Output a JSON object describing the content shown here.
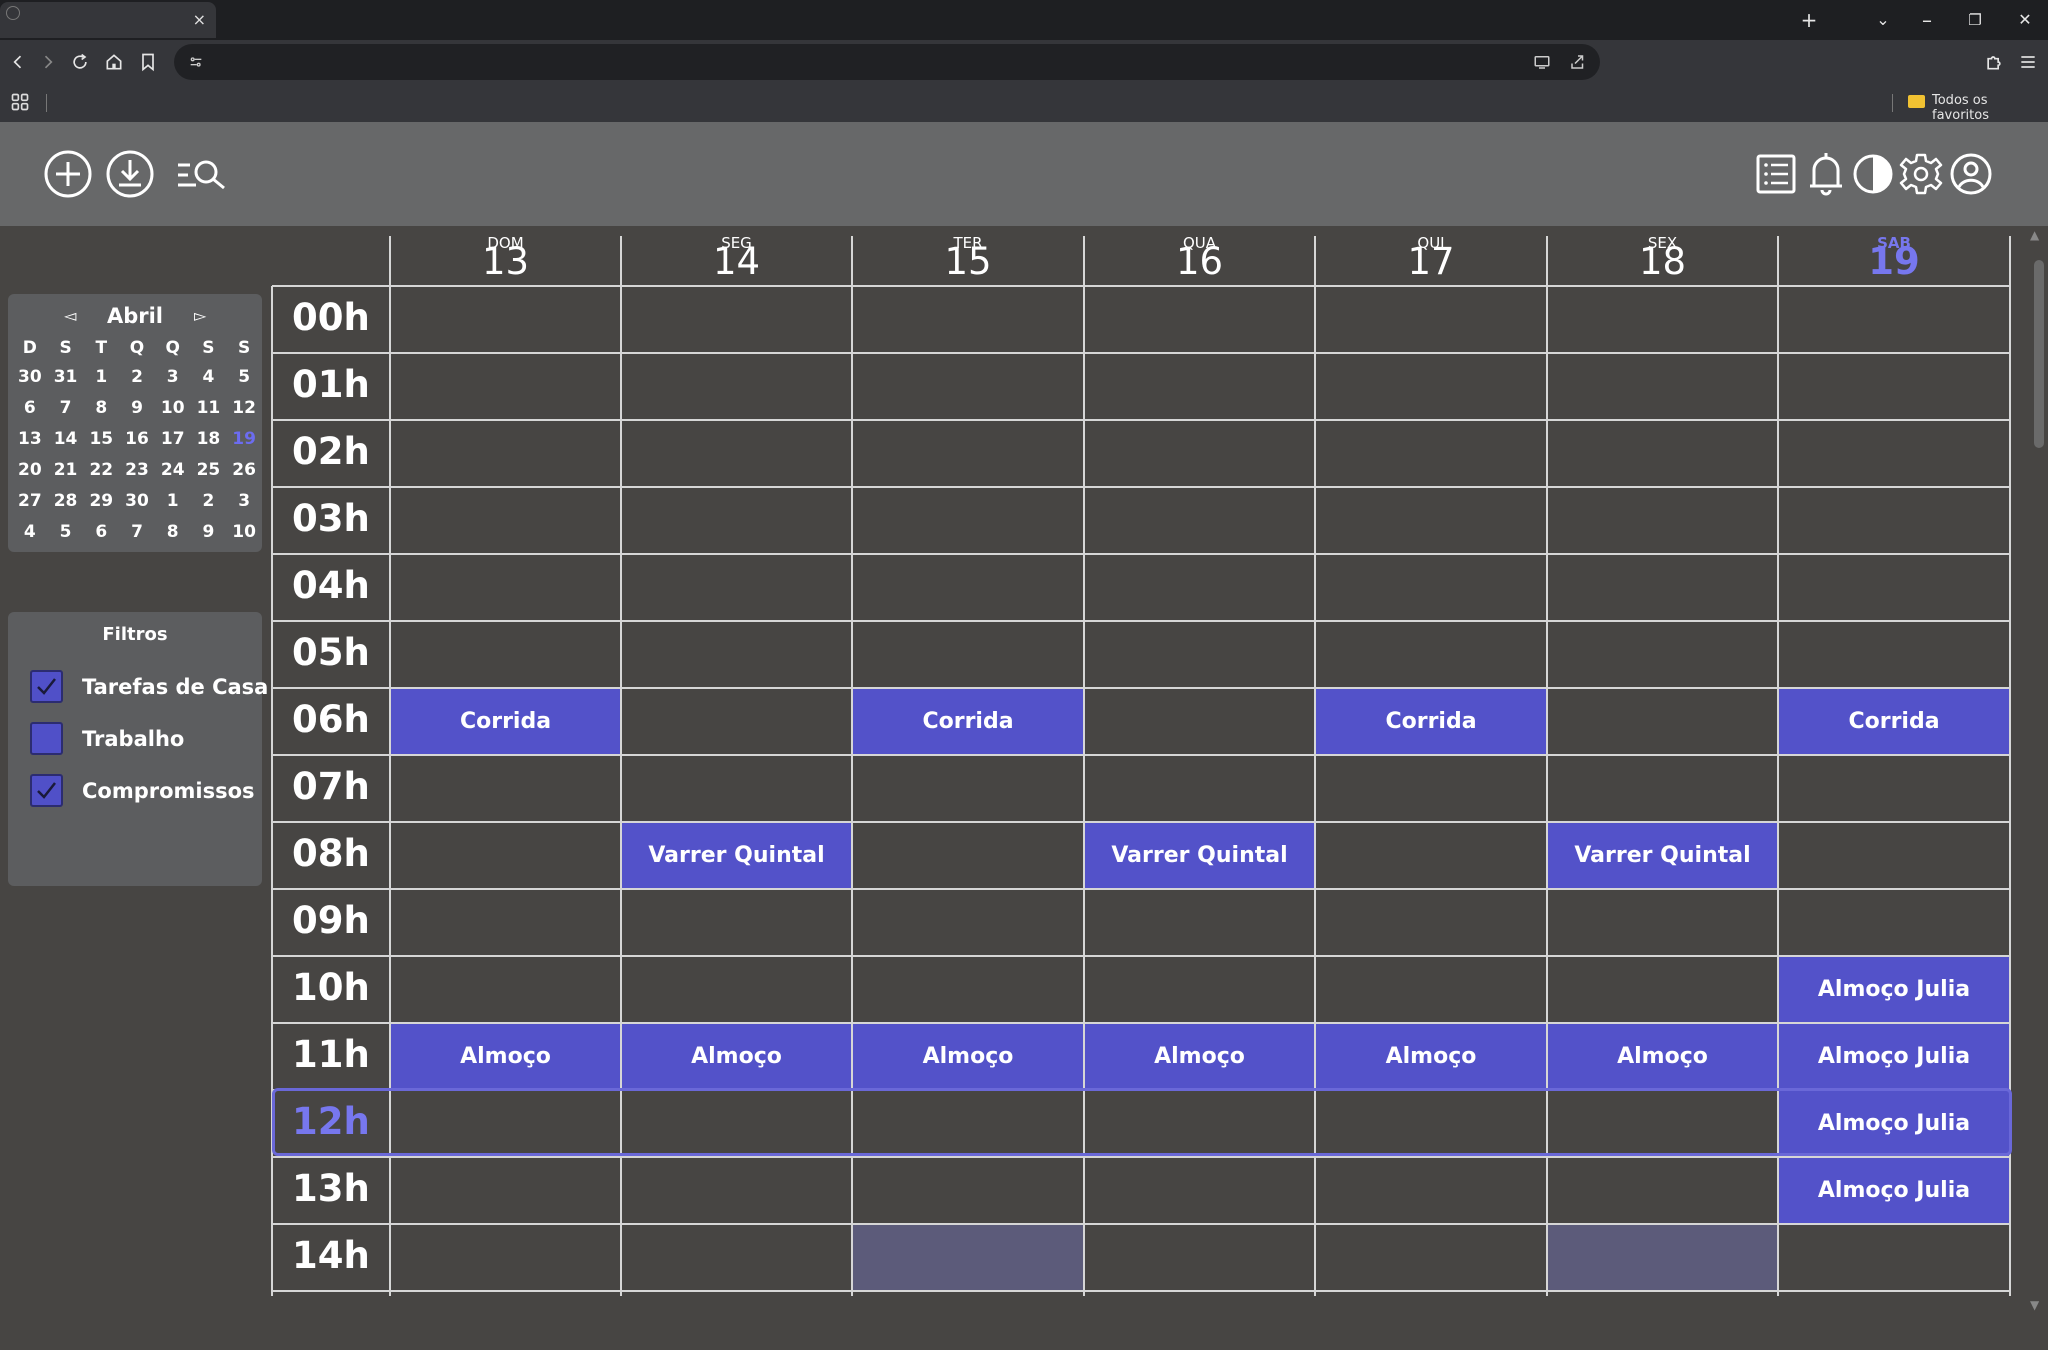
{
  "browser": {
    "tab_close": "×",
    "new_tab": "+",
    "tab_search": "⌄",
    "minimize": "–",
    "restore": "❐",
    "close": "✕",
    "bookmark_folder": "Todos os favoritos"
  },
  "calendar": {
    "month": "Abril",
    "prev": "◅",
    "next": "▻",
    "weekday_initials": [
      "D",
      "S",
      "T",
      "Q",
      "Q",
      "S",
      "S"
    ],
    "weeks": [
      [
        "30",
        "31",
        "1",
        "2",
        "3",
        "4",
        "5"
      ],
      [
        "6",
        "7",
        "8",
        "9",
        "10",
        "11",
        "12"
      ],
      [
        "13",
        "14",
        "15",
        "16",
        "17",
        "18",
        "19"
      ],
      [
        "20",
        "21",
        "22",
        "23",
        "24",
        "25",
        "26"
      ],
      [
        "27",
        "28",
        "29",
        "30",
        "1",
        "2",
        "3"
      ],
      [
        "4",
        "5",
        "6",
        "7",
        "8",
        "9",
        "10"
      ]
    ],
    "today": "19"
  },
  "filters": {
    "title": "Filtros",
    "items": [
      {
        "label": "Tarefas de Casa",
        "checked": true
      },
      {
        "label": "Trabalho",
        "checked": false
      },
      {
        "label": "Compromissos",
        "checked": true
      }
    ]
  },
  "week": {
    "days": [
      {
        "dow": "DOM",
        "num": "13"
      },
      {
        "dow": "SEG",
        "num": "14"
      },
      {
        "dow": "TER",
        "num": "15"
      },
      {
        "dow": "QUA",
        "num": "16"
      },
      {
        "dow": "QUI",
        "num": "17"
      },
      {
        "dow": "SEX",
        "num": "18"
      },
      {
        "dow": "SAB",
        "num": "19",
        "today": true
      }
    ],
    "hours": [
      "00h",
      "01h",
      "02h",
      "03h",
      "04h",
      "05h",
      "06h",
      "07h",
      "08h",
      "09h",
      "10h",
      "11h",
      "12h",
      "13h",
      "14h"
    ],
    "current_hour": "12h",
    "events": [
      {
        "title": "Corrida",
        "day": 0,
        "hour": 6
      },
      {
        "title": "Corrida",
        "day": 2,
        "hour": 6
      },
      {
        "title": "Corrida",
        "day": 4,
        "hour": 6
      },
      {
        "title": "Corrida",
        "day": 6,
        "hour": 6
      },
      {
        "title": "Varrer Quintal",
        "day": 1,
        "hour": 8
      },
      {
        "title": "Varrer Quintal",
        "day": 3,
        "hour": 8
      },
      {
        "title": "Varrer Quintal",
        "day": 5,
        "hour": 8
      },
      {
        "title": "Almoço Julia",
        "day": 6,
        "hour": 10
      },
      {
        "title": "Almoço",
        "day": 0,
        "hour": 11
      },
      {
        "title": "Almoço",
        "day": 1,
        "hour": 11
      },
      {
        "title": "Almoço",
        "day": 2,
        "hour": 11
      },
      {
        "title": "Almoço",
        "day": 3,
        "hour": 11
      },
      {
        "title": "Almoço",
        "day": 4,
        "hour": 11
      },
      {
        "title": "Almoço",
        "day": 5,
        "hour": 11
      },
      {
        "title": "Almoço Julia",
        "day": 6,
        "hour": 11
      },
      {
        "title": "Almoço Julia",
        "day": 6,
        "hour": 12
      },
      {
        "title": "Almoço Julia",
        "day": 6,
        "hour": 13
      }
    ],
    "highlighted_slots": [
      {
        "day": 2,
        "hour": 14
      },
      {
        "day": 5,
        "hour": 14
      }
    ]
  },
  "colors": {
    "event": "#5352c9",
    "today": "#7777ee",
    "highlight": "#5c5b7a"
  },
  "icons": {
    "add": "add-circle-icon",
    "download": "download-circle-icon",
    "search": "filter-search-icon",
    "list": "list-icon",
    "bell": "bell-icon",
    "contrast": "contrast-icon",
    "settings": "gear-icon",
    "user": "user-icon"
  }
}
